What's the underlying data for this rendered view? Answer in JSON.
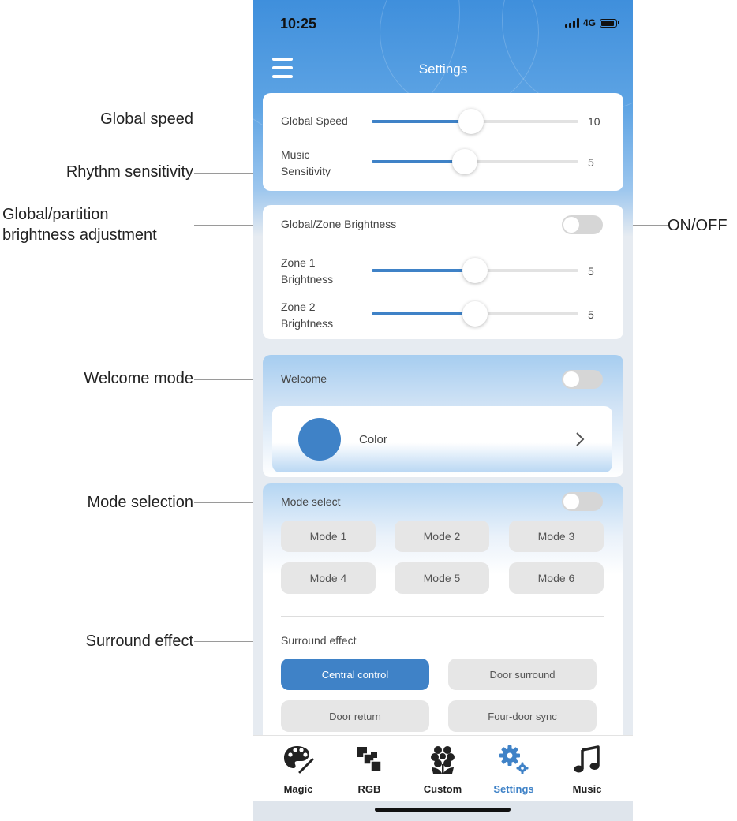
{
  "annotations": {
    "global_speed": "Global speed",
    "rhythm_sensitivity": "Rhythm sensitivity",
    "brightness_line1": "Global/partition",
    "brightness_line2": "brightness adjustment",
    "on_off": "ON/OFF",
    "welcome_mode": "Welcome mode",
    "mode_selection": "Mode selection",
    "surround_effect": "Surround effect"
  },
  "status_bar": {
    "time": "10:25",
    "network": "4G",
    "battery_level": 1.0
  },
  "header": {
    "title": "Settings",
    "menu_icon": "hamburger-menu-icon"
  },
  "speed_card": {
    "global_speed": {
      "label": "Global Speed",
      "value": "10",
      "level": 0.48
    },
    "music_sensitivity": {
      "label_line1": "Music",
      "label_line2": "Sensitivity",
      "value": "5",
      "level": 0.45
    }
  },
  "brightness_card": {
    "title": "Global/Zone Brightness",
    "toggle_on": false,
    "zone1": {
      "label_line1": "Zone 1",
      "label_line2": "Brightness",
      "value": "5",
      "level": 0.5
    },
    "zone2": {
      "label_line1": "Zone 2",
      "label_line2": "Brightness",
      "value": "5",
      "level": 0.5
    }
  },
  "welcome": {
    "title": "Welcome",
    "toggle_on": false,
    "color_label": "Color",
    "color_swatch": "#3f82c7",
    "chevron_icon": "chevron-right-icon"
  },
  "mode_select": {
    "title": "Mode select",
    "toggle_on": false,
    "modes": [
      "Mode 1",
      "Mode 2",
      "Mode 3",
      "Mode 4",
      "Mode 5",
      "Mode 6"
    ]
  },
  "surround": {
    "title": "Surround effect",
    "options": [
      "Central control",
      "Door surround",
      "Door return",
      "Four-door sync"
    ],
    "selected": "Central control"
  },
  "tabs": [
    {
      "label": "Magic",
      "icon": "palette-icon"
    },
    {
      "label": "RGB",
      "icon": "rgb-squares-icon"
    },
    {
      "label": "Custom",
      "icon": "flower-icon"
    },
    {
      "label": "Settings",
      "icon": "gears-icon",
      "active": true
    },
    {
      "label": "Music",
      "icon": "music-note-icon"
    }
  ],
  "colors": {
    "accent": "#3f82c7",
    "track": "#e2e2e2",
    "toggle_off": "#d6d6d6"
  }
}
